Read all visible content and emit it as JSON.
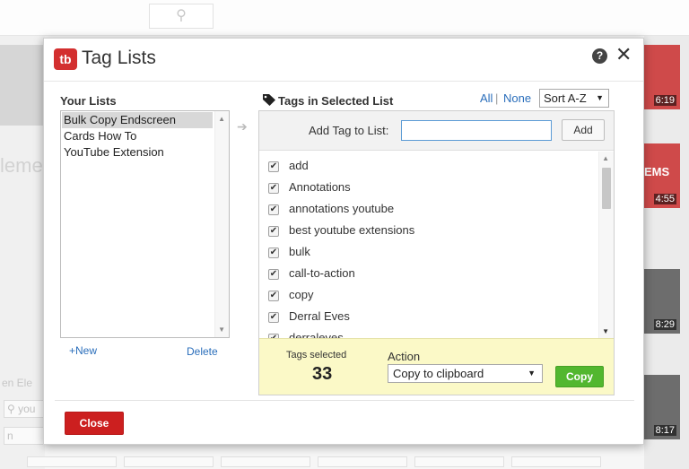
{
  "background": {
    "partial_word": "leme",
    "partial_text": "en Ele",
    "search_value": "you",
    "bottom_left_text": "n",
    "durations": [
      "6:19",
      "4:55",
      "8:29",
      "8:17"
    ],
    "thumb_caption": "EMS"
  },
  "dialog": {
    "logo_text": "tb",
    "title": "Tag Lists",
    "help_glyph": "?",
    "close_glyph": "✕"
  },
  "lists": {
    "heading": "Your Lists",
    "items": [
      "Bulk Copy Endscreen",
      "Cards How To",
      "YouTube Extension"
    ],
    "selected_index": 0,
    "new_label": "+New",
    "delete_label": "Delete"
  },
  "tags": {
    "heading": "Tags in Selected List",
    "all_label": "All",
    "separator": "|",
    "none_label": "None",
    "sort_value": "Sort A-Z",
    "add_label": "Add Tag to List:",
    "add_value": "",
    "add_button": "Add",
    "items": [
      "add",
      "Annotations",
      "annotations youtube",
      "best youtube extensions",
      "bulk",
      "call-to-action",
      "copy",
      "Derral Eves",
      "derraleves"
    ]
  },
  "footer": {
    "selected_label": "Tags selected",
    "selected_count": "33",
    "action_label": "Action",
    "action_value": "Copy to clipboard",
    "copy_button": "Copy"
  },
  "close_button": "Close",
  "colors": {
    "brand_red": "#d32f2f",
    "link_blue": "#2a6ebb",
    "copy_green": "#52b72f",
    "footer_yellow": "#fbf9c7",
    "close_red": "#cc1f1f"
  }
}
